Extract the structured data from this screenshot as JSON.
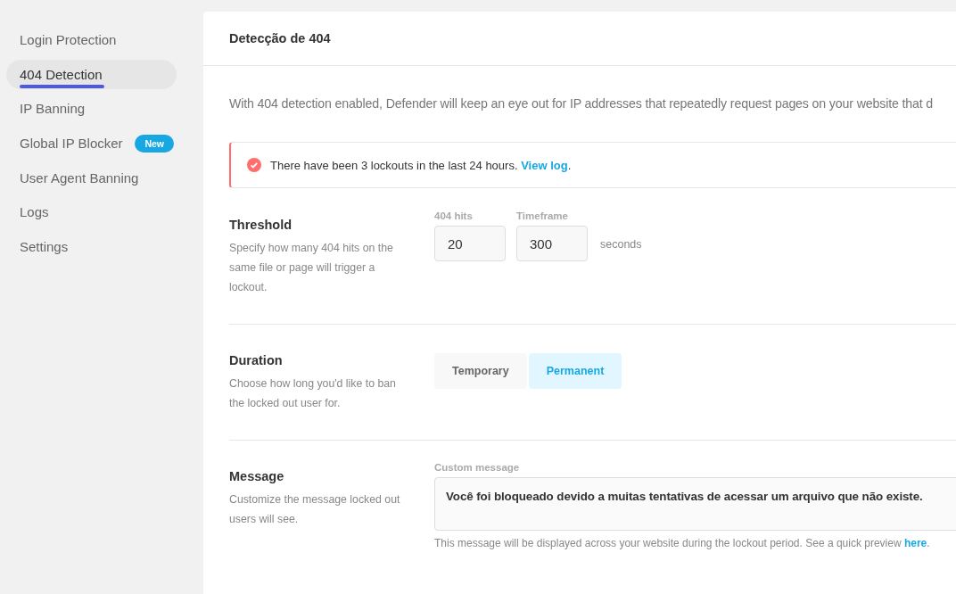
{
  "sidebar": {
    "items": [
      {
        "label": "Login Protection",
        "selected": false
      },
      {
        "label": "404 Detection",
        "selected": true
      },
      {
        "label": "IP Banning",
        "selected": false
      },
      {
        "label": "Global IP Blocker",
        "selected": false,
        "badge": "New"
      },
      {
        "label": "User Agent Banning",
        "selected": false
      },
      {
        "label": "Logs",
        "selected": false
      },
      {
        "label": "Settings",
        "selected": false
      }
    ]
  },
  "panel": {
    "title": "Detecção de 404",
    "intro": "With 404 detection enabled, Defender will keep an eye out for IP addresses that repeatedly request pages on your website that d",
    "notice": {
      "text": "There have been 3 lockouts in the last 24 hours.",
      "link": "View log",
      "after": "."
    },
    "sections": [
      {
        "kind": "threshold",
        "title": "Threshold",
        "description": "Specify how many 404 hits on the same file or page will trigger a lockout.",
        "fields": [
          {
            "label": "404 hits",
            "value": "20"
          },
          {
            "label": "Timeframe",
            "value": "300"
          }
        ],
        "unit": "seconds"
      },
      {
        "kind": "duration",
        "title": "Duration",
        "description": "Choose how long you'd like to ban the locked out user for.",
        "options": [
          {
            "label": "Temporary",
            "selected": false
          },
          {
            "label": "Permanent",
            "selected": true
          }
        ]
      },
      {
        "kind": "message",
        "title": "Message",
        "description": "Customize the message locked out users will see.",
        "field_label": "Custom message",
        "value": "Você foi bloqueado devido a muitas tentativas de acessar um arquivo que não existe.",
        "help": {
          "text": "This message will be displayed across your website during the lockout period. See a quick preview",
          "link": "here",
          "after": "."
        }
      }
    ]
  }
}
